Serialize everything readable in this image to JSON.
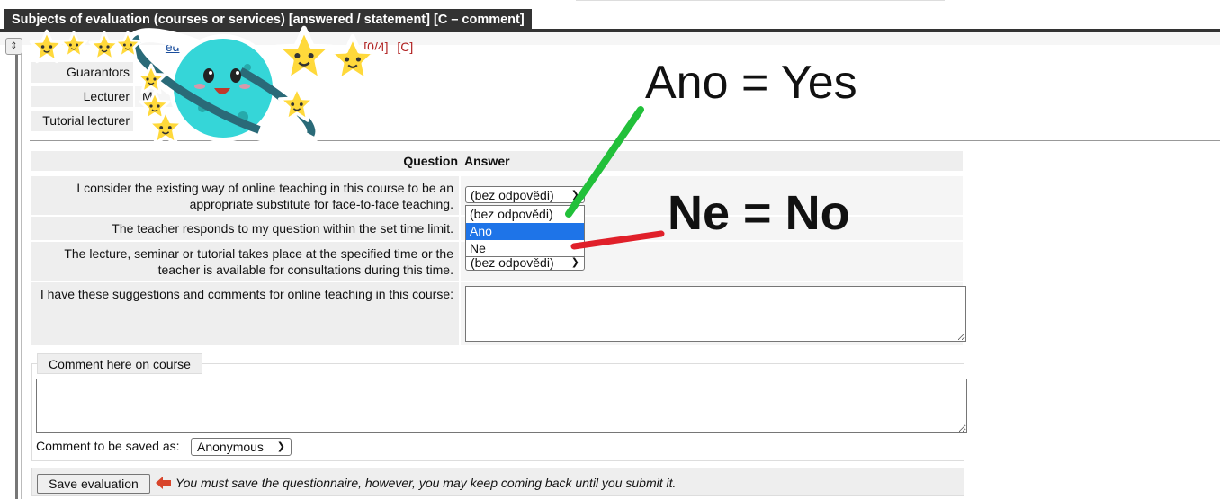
{
  "header": {
    "title": "Subjects of evaluation (courses or services) [answered / statement] [C – comment]"
  },
  "course": {
    "link_fragments": [
      "I",
      "ed",
      "liti",
      "u"
    ],
    "count": "[0/4]",
    "comment_marker": "[C]"
  },
  "people": [
    {
      "label": "Guarantors",
      "value": ""
    },
    {
      "label": "Lecturer",
      "value": "M"
    },
    {
      "label": "Tutorial lecturer",
      "value": ""
    }
  ],
  "table": {
    "question_header": "Question",
    "answer_header": "Answer",
    "rows": [
      {
        "question": "I consider the existing way of online teaching in this course to be an appropriate substitute for face-to-face teaching.",
        "answer": "(bez odpovědi)"
      },
      {
        "question": "The teacher responds to my question within the set time limit.",
        "answer": ""
      },
      {
        "question": "The lecture, seminar or tutorial takes place at the specified time or the teacher is available for consultations during this time.",
        "answer": "(bez odpovědi)"
      },
      {
        "question": "I have these suggestions and comments for online teaching in this course:",
        "answer": ""
      }
    ]
  },
  "dropdown": {
    "options": [
      "(bez odpovědi)",
      "Ano",
      "Ne"
    ],
    "highlighted": "Ano"
  },
  "comment": {
    "legend": "Comment here on course",
    "saved_as_label": "Comment to be saved as:",
    "saved_as_value": "Anonymous"
  },
  "save": {
    "button_label": "Save evaluation",
    "note": "You must save the questionnaire, however, you may keep coming back until you submit it."
  },
  "annotations": {
    "yes": "Ano = Yes",
    "no": "Ne = No",
    "yes_color": "#22c03a",
    "no_color": "#e0202a"
  },
  "colors": {
    "header_bg": "#333333",
    "highlight": "#1e74e8",
    "panel_bg": "#eeeeee"
  },
  "icons": {
    "collapse": "collapse-toggle-icon",
    "chevron": "chevron-down-icon",
    "arrow": "left-arrow-icon",
    "planet": "planet-sticker",
    "star": "star-sticker"
  }
}
